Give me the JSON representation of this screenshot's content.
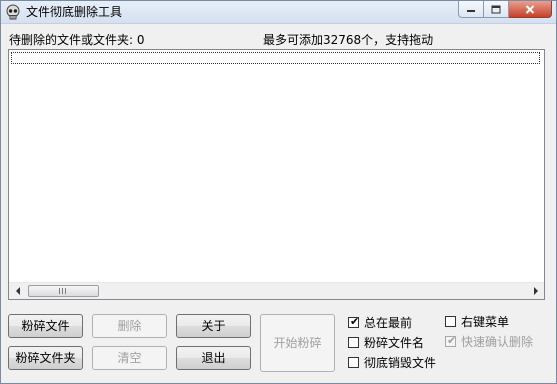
{
  "window": {
    "title": "文件彻底删除工具"
  },
  "status": {
    "pending_label": "待删除的文件或文件夹: 0",
    "limit_label": "最多可添加32768个，支持拖动"
  },
  "list": {
    "items": []
  },
  "buttons": {
    "shred_file": "粉碎文件",
    "delete": "删除",
    "about": "关于",
    "start_shred": "开始粉碎",
    "shred_folder": "粉碎文件夹",
    "clear": "清空",
    "exit": "退出"
  },
  "options": {
    "always_on_top": {
      "label": "总在最前",
      "checked": true
    },
    "right_click_menu": {
      "label": "右键菜单",
      "checked": false
    },
    "shred_filename": {
      "label": "粉碎文件名",
      "checked": false
    },
    "quick_confirm_delete": {
      "label": "快速确认删除",
      "checked": true,
      "disabled": true
    },
    "thorough_destroy": {
      "label": "彻底销毁文件",
      "checked": false
    }
  }
}
